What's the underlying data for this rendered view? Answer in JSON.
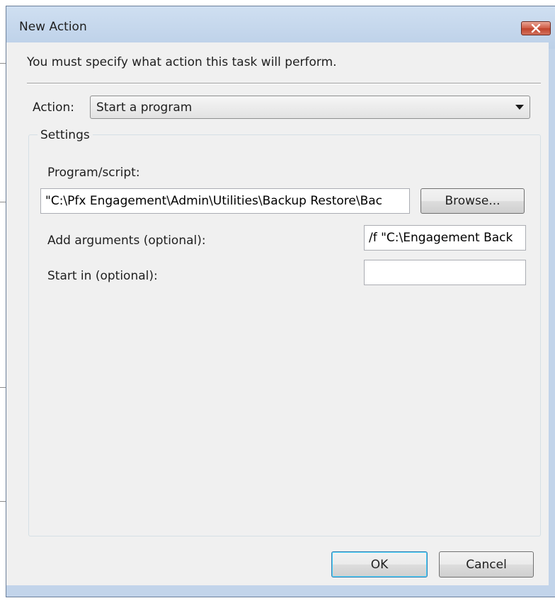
{
  "window": {
    "title": "New Action"
  },
  "dialog": {
    "instruction": "You must specify what action this task will perform.",
    "action_label": "Action:",
    "action_value": "Start a program",
    "settings_label": "Settings",
    "program_label": "Program/script:",
    "program_value": "\"C:\\Pfx Engagement\\Admin\\Utilities\\Backup Restore\\Bac",
    "browse_label": "Browse...",
    "arguments_label": "Add arguments (optional):",
    "arguments_value": "/f \"C:\\Engagement Back",
    "start_in_label": "Start in (optional):",
    "start_in_value": "",
    "ok_label": "OK",
    "cancel_label": "Cancel"
  },
  "icons": {
    "close": "close-icon",
    "dropdown": "chevron-down-icon"
  },
  "colors": {
    "title_bar": "#c2d4ea",
    "close_button": "#c7472f",
    "client_area": "#f0f0f0",
    "default_button_border": "#3c7fb1"
  }
}
